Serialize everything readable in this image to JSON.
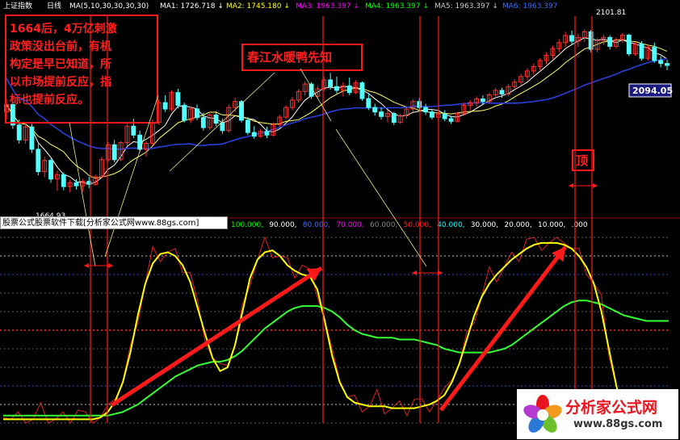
{
  "header": {
    "index_name": "上证指数",
    "period": "日线",
    "ma_text": "MA(5,10,30,30,30,30)",
    "ma_items": [
      {
        "label": "MA1:",
        "value": "1726.718",
        "arrow": "↓",
        "color": "#ffffff"
      },
      {
        "label": "MA2:",
        "value": "1745.180",
        "arrow": "↓",
        "color": "#ffff00"
      },
      {
        "label": "MA3:",
        "value": "1963.397",
        "arrow": "↓",
        "color": "#ff00ff"
      },
      {
        "label": "MA4:",
        "value": "1963.397",
        "arrow": "↓",
        "color": "#00ff00"
      },
      {
        "label": "MA5:",
        "value": "1963.397",
        "arrow": "↓",
        "color": "#cccccc"
      },
      {
        "label": "MA6:",
        "value": "1963.397",
        "arrow": "",
        "color": "#3a6cff"
      }
    ]
  },
  "annotations": {
    "box_left_text": "1664后，4万亿刺激政策没出台前，有机构定是早已知道，所以市场提前反应，指标也提前反应。",
    "box_left_lines": [
      "1664后，4万亿刺激",
      "政策没出台前，有机",
      "构定是早已知道，所",
      "以市场提前反应，指",
      "标也提前反应。"
    ],
    "box_mid_text": "春江水暖鸭先知",
    "top_label": "顶",
    "low_label": "1664.93",
    "high_label": "2101.81",
    "price_tag": "2094.05"
  },
  "indicator_header": {
    "levels": [
      "100.000",
      "90.000",
      "80.000",
      "70.000",
      "60.000",
      "50.000",
      "40.000",
      "30.000",
      "20.000",
      "10.000",
      ".000"
    ],
    "level_colors": [
      "#00ff00",
      "#ffffff",
      "#3a6cff",
      "#ff00ff",
      "#888888",
      "#ff2222",
      "#00ffff",
      "#ffffff",
      "#ffffff",
      "#ffffff",
      "#ffffff"
    ]
  },
  "watermark": {
    "text": "股票公式股票软件下载[分析家公式网www.88gs.com]"
  },
  "logo": {
    "title": "分析家公式网",
    "url": "www.88gs.com"
  },
  "colors": {
    "background": "#000000",
    "up_candle": "#ff3232",
    "down_candle": "#54ffff",
    "annotation_red": "#ff1a1a",
    "ma_yellow": "#ffff66",
    "ma_white": "#ffffff",
    "ma_blue": "#2c3fd8",
    "ind_fast": "#ffff00",
    "ind_slow": "#33ff33",
    "ind_raw": "#dd2222"
  },
  "chart_data": [
    {
      "type": "candlestick",
      "title": "上证指数 日线",
      "ylim": [
        1600,
        2150
      ],
      "low_point": 1664.93,
      "high_point": 2101.81,
      "last_close": 2094.05,
      "candles": [
        {
          "o": 1880,
          "h": 1915,
          "l": 1860,
          "c": 1900
        },
        {
          "o": 1900,
          "h": 1910,
          "l": 1835,
          "c": 1845
        },
        {
          "o": 1845,
          "h": 1860,
          "l": 1795,
          "c": 1805
        },
        {
          "o": 1805,
          "h": 1850,
          "l": 1795,
          "c": 1840
        },
        {
          "o": 1840,
          "h": 1848,
          "l": 1770,
          "c": 1780
        },
        {
          "o": 1780,
          "h": 1795,
          "l": 1710,
          "c": 1720
        },
        {
          "o": 1720,
          "h": 1760,
          "l": 1705,
          "c": 1750
        },
        {
          "o": 1750,
          "h": 1755,
          "l": 1690,
          "c": 1700
        },
        {
          "o": 1700,
          "h": 1722,
          "l": 1668,
          "c": 1712
        },
        {
          "o": 1712,
          "h": 1718,
          "l": 1670,
          "c": 1680
        },
        {
          "o": 1680,
          "h": 1698,
          "l": 1665,
          "c": 1690
        },
        {
          "o": 1690,
          "h": 1700,
          "l": 1672,
          "c": 1682
        },
        {
          "o": 1682,
          "h": 1700,
          "l": 1666,
          "c": 1694
        },
        {
          "o": 1694,
          "h": 1706,
          "l": 1676,
          "c": 1686
        },
        {
          "o": 1686,
          "h": 1712,
          "l": 1682,
          "c": 1706
        },
        {
          "o": 1706,
          "h": 1760,
          "l": 1702,
          "c": 1752
        },
        {
          "o": 1752,
          "h": 1800,
          "l": 1745,
          "c": 1792
        },
        {
          "o": 1792,
          "h": 1805,
          "l": 1745,
          "c": 1752
        },
        {
          "o": 1752,
          "h": 1802,
          "l": 1748,
          "c": 1798
        },
        {
          "o": 1798,
          "h": 1850,
          "l": 1790,
          "c": 1842
        },
        {
          "o": 1842,
          "h": 1862,
          "l": 1810,
          "c": 1818
        },
        {
          "o": 1818,
          "h": 1830,
          "l": 1772,
          "c": 1780
        },
        {
          "o": 1780,
          "h": 1802,
          "l": 1760,
          "c": 1796
        },
        {
          "o": 1796,
          "h": 1860,
          "l": 1790,
          "c": 1852
        },
        {
          "o": 1852,
          "h": 1915,
          "l": 1845,
          "c": 1905
        },
        {
          "o": 1905,
          "h": 1925,
          "l": 1880,
          "c": 1888
        },
        {
          "o": 1888,
          "h": 1938,
          "l": 1882,
          "c": 1932
        },
        {
          "o": 1932,
          "h": 1942,
          "l": 1890,
          "c": 1898
        },
        {
          "o": 1898,
          "h": 1905,
          "l": 1852,
          "c": 1858
        },
        {
          "o": 1858,
          "h": 1895,
          "l": 1850,
          "c": 1888
        },
        {
          "o": 1888,
          "h": 1900,
          "l": 1858,
          "c": 1865
        },
        {
          "o": 1865,
          "h": 1878,
          "l": 1830,
          "c": 1838
        },
        {
          "o": 1838,
          "h": 1880,
          "l": 1832,
          "c": 1872
        },
        {
          "o": 1872,
          "h": 1882,
          "l": 1842,
          "c": 1850
        },
        {
          "o": 1850,
          "h": 1862,
          "l": 1822,
          "c": 1830
        },
        {
          "o": 1830,
          "h": 1900,
          "l": 1825,
          "c": 1892
        },
        {
          "o": 1892,
          "h": 1918,
          "l": 1880,
          "c": 1908
        },
        {
          "o": 1908,
          "h": 1912,
          "l": 1852,
          "c": 1858
        },
        {
          "o": 1858,
          "h": 1866,
          "l": 1818,
          "c": 1825
        },
        {
          "o": 1825,
          "h": 1842,
          "l": 1808,
          "c": 1815
        },
        {
          "o": 1815,
          "h": 1835,
          "l": 1810,
          "c": 1828
        },
        {
          "o": 1828,
          "h": 1840,
          "l": 1810,
          "c": 1818
        },
        {
          "o": 1818,
          "h": 1852,
          "l": 1815,
          "c": 1846
        },
        {
          "o": 1846,
          "h": 1872,
          "l": 1840,
          "c": 1866
        },
        {
          "o": 1866,
          "h": 1898,
          "l": 1860,
          "c": 1892
        },
        {
          "o": 1892,
          "h": 1920,
          "l": 1885,
          "c": 1912
        },
        {
          "o": 1912,
          "h": 1942,
          "l": 1905,
          "c": 1935
        },
        {
          "o": 1935,
          "h": 1962,
          "l": 1925,
          "c": 1955
        },
        {
          "o": 1955,
          "h": 1960,
          "l": 1915,
          "c": 1922
        },
        {
          "o": 1922,
          "h": 1950,
          "l": 1915,
          "c": 1942
        },
        {
          "o": 1942,
          "h": 1975,
          "l": 1935,
          "c": 1966
        },
        {
          "o": 1966,
          "h": 1985,
          "l": 1940,
          "c": 1948
        },
        {
          "o": 1948,
          "h": 1975,
          "l": 1930,
          "c": 1938
        },
        {
          "o": 1938,
          "h": 1960,
          "l": 1922,
          "c": 1950
        },
        {
          "o": 1950,
          "h": 1972,
          "l": 1925,
          "c": 1932
        },
        {
          "o": 1932,
          "h": 1965,
          "l": 1928,
          "c": 1958
        },
        {
          "o": 1958,
          "h": 1962,
          "l": 1910,
          "c": 1916
        },
        {
          "o": 1916,
          "h": 1930,
          "l": 1885,
          "c": 1892
        },
        {
          "o": 1892,
          "h": 1902,
          "l": 1870,
          "c": 1880
        },
        {
          "o": 1880,
          "h": 1892,
          "l": 1860,
          "c": 1868
        },
        {
          "o": 1868,
          "h": 1885,
          "l": 1852,
          "c": 1876
        },
        {
          "o": 1876,
          "h": 1880,
          "l": 1845,
          "c": 1852
        },
        {
          "o": 1852,
          "h": 1875,
          "l": 1848,
          "c": 1870
        },
        {
          "o": 1870,
          "h": 1895,
          "l": 1862,
          "c": 1888
        },
        {
          "o": 1888,
          "h": 1915,
          "l": 1880,
          "c": 1908
        },
        {
          "o": 1908,
          "h": 1918,
          "l": 1885,
          "c": 1892
        },
        {
          "o": 1892,
          "h": 1902,
          "l": 1872,
          "c": 1880
        },
        {
          "o": 1880,
          "h": 1888,
          "l": 1860,
          "c": 1866
        },
        {
          "o": 1866,
          "h": 1880,
          "l": 1855,
          "c": 1874
        },
        {
          "o": 1874,
          "h": 1885,
          "l": 1855,
          "c": 1862
        },
        {
          "o": 1862,
          "h": 1870,
          "l": 1848,
          "c": 1855
        },
        {
          "o": 1855,
          "h": 1880,
          "l": 1852,
          "c": 1876
        },
        {
          "o": 1876,
          "h": 1905,
          "l": 1870,
          "c": 1898
        },
        {
          "o": 1898,
          "h": 1912,
          "l": 1885,
          "c": 1905
        },
        {
          "o": 1905,
          "h": 1922,
          "l": 1895,
          "c": 1915
        },
        {
          "o": 1915,
          "h": 1925,
          "l": 1898,
          "c": 1908
        },
        {
          "o": 1908,
          "h": 1932,
          "l": 1902,
          "c": 1926
        },
        {
          "o": 1926,
          "h": 1945,
          "l": 1915,
          "c": 1938
        },
        {
          "o": 1938,
          "h": 1945,
          "l": 1918,
          "c": 1928
        },
        {
          "o": 1928,
          "h": 1955,
          "l": 1922,
          "c": 1948
        },
        {
          "o": 1948,
          "h": 1968,
          "l": 1940,
          "c": 1960
        },
        {
          "o": 1960,
          "h": 1982,
          "l": 1952,
          "c": 1975
        },
        {
          "o": 1975,
          "h": 1998,
          "l": 1965,
          "c": 1990
        },
        {
          "o": 1990,
          "h": 2010,
          "l": 1980,
          "c": 2002
        },
        {
          "o": 2002,
          "h": 2025,
          "l": 1992,
          "c": 2018
        },
        {
          "o": 2018,
          "h": 2040,
          "l": 2008,
          "c": 2032
        },
        {
          "o": 2032,
          "h": 2058,
          "l": 2022,
          "c": 2050
        },
        {
          "o": 2050,
          "h": 2075,
          "l": 2040,
          "c": 2066
        },
        {
          "o": 2066,
          "h": 2095,
          "l": 2055,
          "c": 2085
        },
        {
          "o": 2085,
          "h": 2098,
          "l": 2060,
          "c": 2070
        },
        {
          "o": 2070,
          "h": 2090,
          "l": 2055,
          "c": 2080
        },
        {
          "o": 2080,
          "h": 2101.81,
          "l": 2068,
          "c": 2095
        },
        {
          "o": 2095,
          "h": 2100,
          "l": 2040,
          "c": 2048
        },
        {
          "o": 2048,
          "h": 2078,
          "l": 2040,
          "c": 2072
        },
        {
          "o": 2072,
          "h": 2088,
          "l": 2060,
          "c": 2080
        },
        {
          "o": 2080,
          "h": 2086,
          "l": 2048,
          "c": 2056
        },
        {
          "o": 2056,
          "h": 2080,
          "l": 2050,
          "c": 2074
        },
        {
          "o": 2074,
          "h": 2092,
          "l": 2066,
          "c": 2086
        },
        {
          "o": 2086,
          "h": 2090,
          "l": 2030,
          "c": 2036
        },
        {
          "o": 2036,
          "h": 2068,
          "l": 2030,
          "c": 2062
        },
        {
          "o": 2062,
          "h": 2070,
          "l": 2018,
          "c": 2024
        },
        {
          "o": 2024,
          "h": 2060,
          "l": 2018,
          "c": 2054
        },
        {
          "o": 2054,
          "h": 2066,
          "l": 2012,
          "c": 2018
        },
        {
          "o": 2018,
          "h": 2030,
          "l": 2000,
          "c": 2010
        },
        {
          "o": 2010,
          "h": 2020,
          "l": 1992,
          "c": 2005
        }
      ]
    },
    {
      "type": "line",
      "title": "",
      "ylim": [
        0,
        100
      ],
      "levels": [
        100,
        90,
        80,
        70,
        60,
        50,
        40,
        30,
        20,
        10,
        0
      ],
      "series": [
        {
          "values": [
            2,
            2,
            2,
            2,
            2,
            2,
            2,
            2,
            2,
            2,
            2,
            2,
            2,
            3,
            6,
            12,
            22,
            38,
            58,
            75,
            86,
            91,
            92,
            90,
            85,
            76,
            62,
            48,
            35,
            28,
            30,
            42,
            60,
            78,
            88,
            92,
            93,
            90,
            85,
            82,
            80,
            79,
            72,
            55,
            36,
            22,
            14,
            11,
            10,
            9,
            9,
            9,
            8,
            8,
            8,
            8,
            9,
            10,
            12,
            15,
            22,
            32,
            45,
            58,
            68,
            75,
            80,
            84,
            88,
            91,
            94,
            96,
            97,
            97,
            97,
            96,
            94,
            90,
            84,
            75,
            60,
            40,
            20,
            5,
            2,
            2,
            2,
            2,
            2,
            2
          ]
        },
        {
          "values": [
            4,
            4,
            4,
            4,
            4,
            4,
            4,
            4,
            4,
            4,
            4,
            4,
            4,
            4,
            4,
            5,
            6,
            8,
            10,
            13,
            16,
            19,
            22,
            25,
            27,
            29,
            31,
            32,
            33,
            33,
            34,
            36,
            39,
            43,
            47,
            51,
            54,
            57,
            60,
            62,
            63,
            63,
            63,
            62,
            60,
            57,
            53,
            50,
            48,
            47,
            46,
            46,
            46,
            45,
            45,
            45,
            44,
            43,
            42,
            40,
            39,
            38,
            38,
            38,
            38,
            38,
            39,
            40,
            42,
            45,
            48,
            51,
            54,
            57,
            60,
            63,
            65,
            66,
            66,
            65,
            64,
            62,
            60,
            58,
            57,
            56,
            55,
            55,
            55,
            55
          ]
        }
      ]
    }
  ]
}
